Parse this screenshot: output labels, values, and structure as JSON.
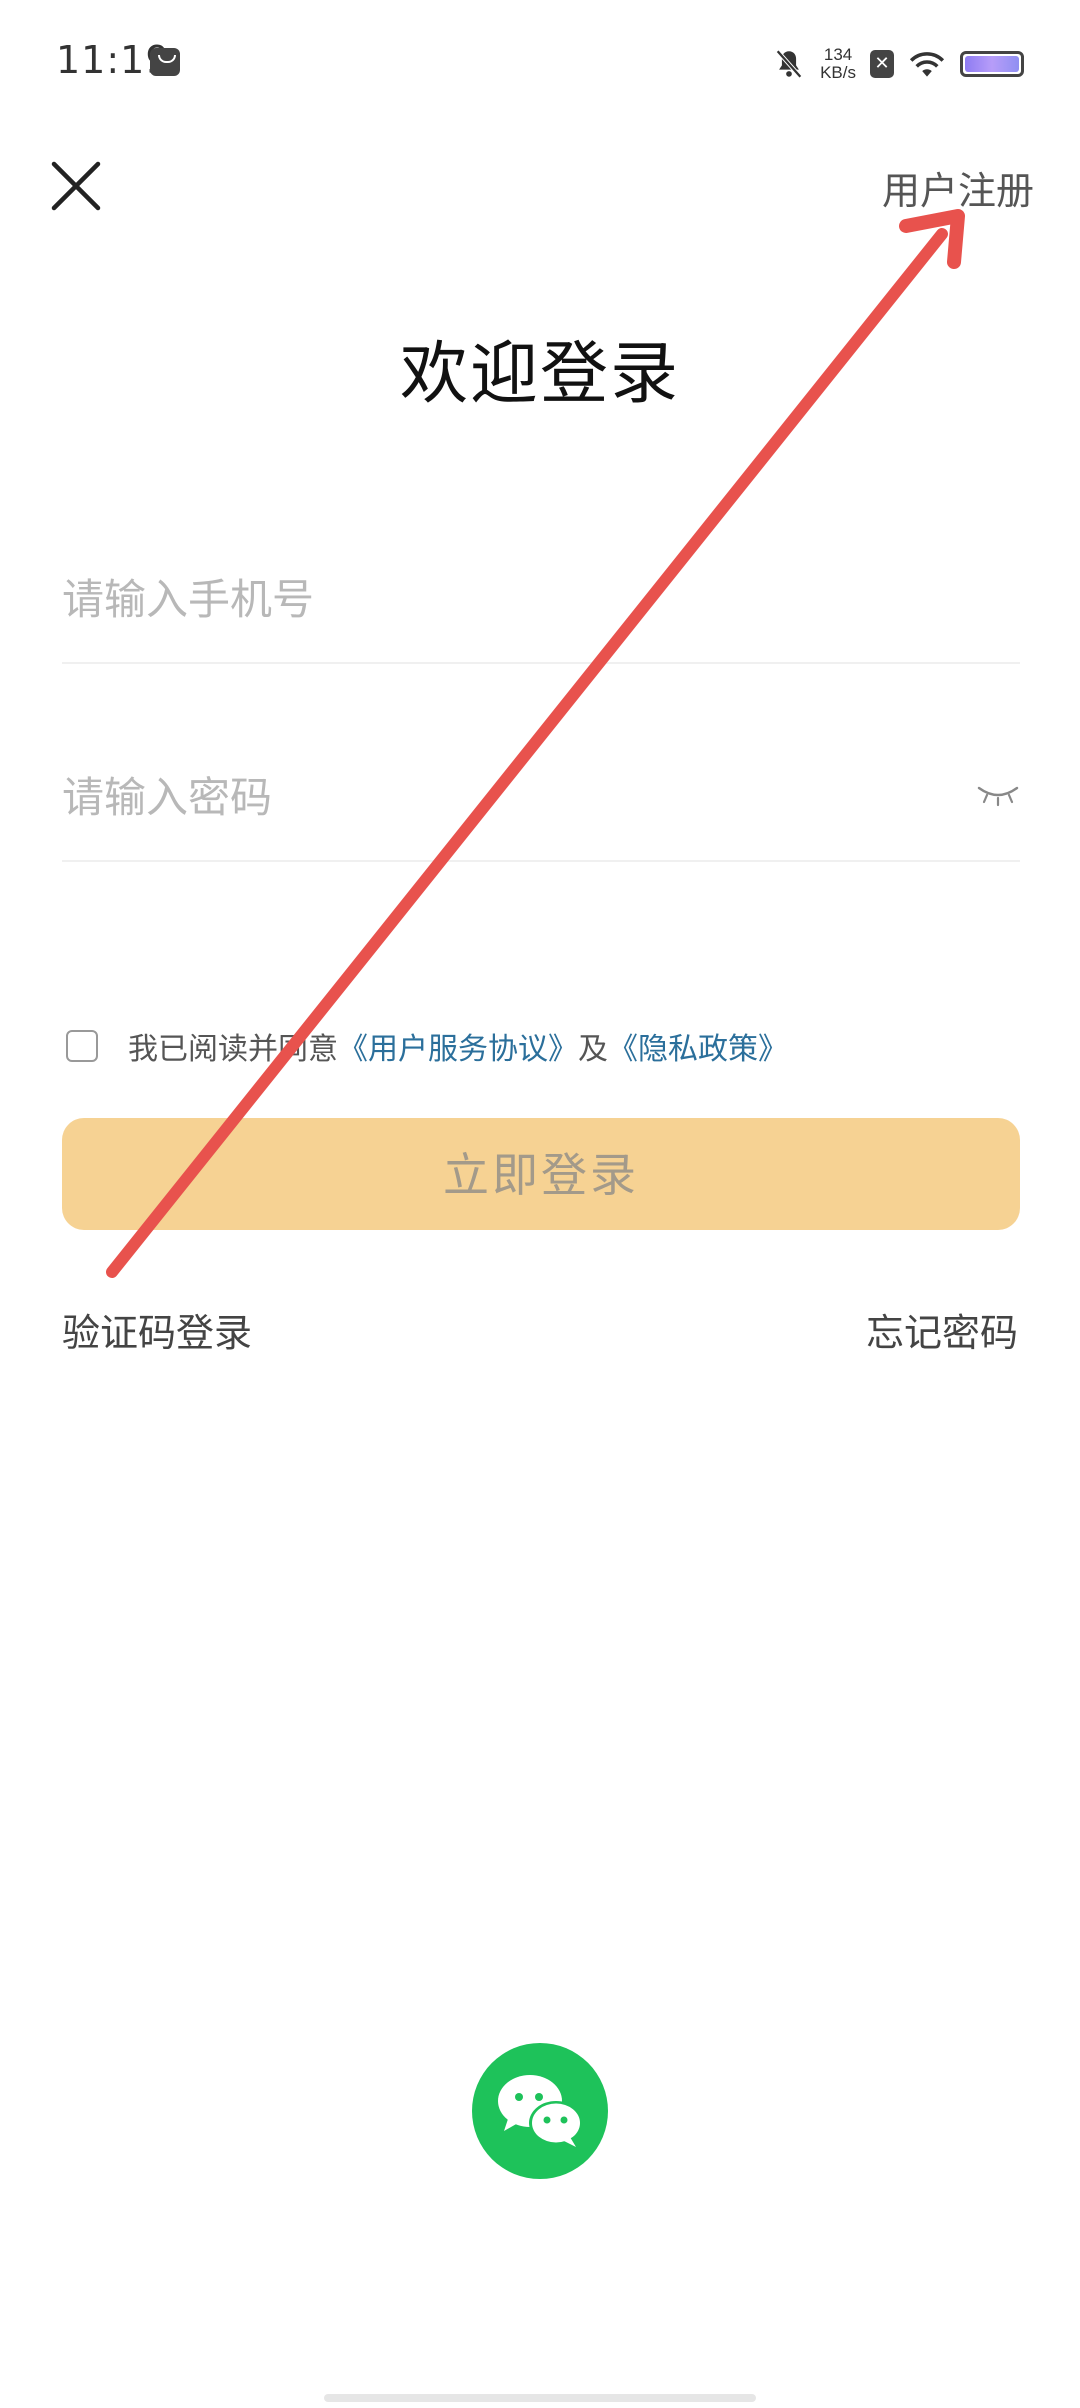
{
  "status_bar": {
    "time": "11:19",
    "speed_value": "134",
    "speed_unit": "KB/s",
    "icons": [
      "shopping-bag-icon",
      "mute-bell-icon",
      "x-icon",
      "wifi-icon",
      "battery-icon"
    ]
  },
  "header": {
    "close_icon": "close-icon",
    "register_label": "用户注册"
  },
  "main": {
    "title": "欢迎登录",
    "phone_placeholder": "请输入手机号",
    "password_placeholder": "请输入密码",
    "agreement": {
      "prefix": "我已阅读并同意",
      "user_agreement": "《用户服务协议》",
      "conjunction": "及",
      "privacy_policy": "《隐私政策》",
      "checked": false
    },
    "login_button": "立即登录",
    "sms_login": "验证码登录",
    "forgot_password": "忘记密码"
  },
  "social": {
    "wechat_icon": "wechat-icon"
  },
  "colors": {
    "login_button_bg": "#f6d293",
    "link": "#2b6f9b",
    "wechat": "#1ec25a",
    "annotation_arrow": "#e8524d"
  }
}
